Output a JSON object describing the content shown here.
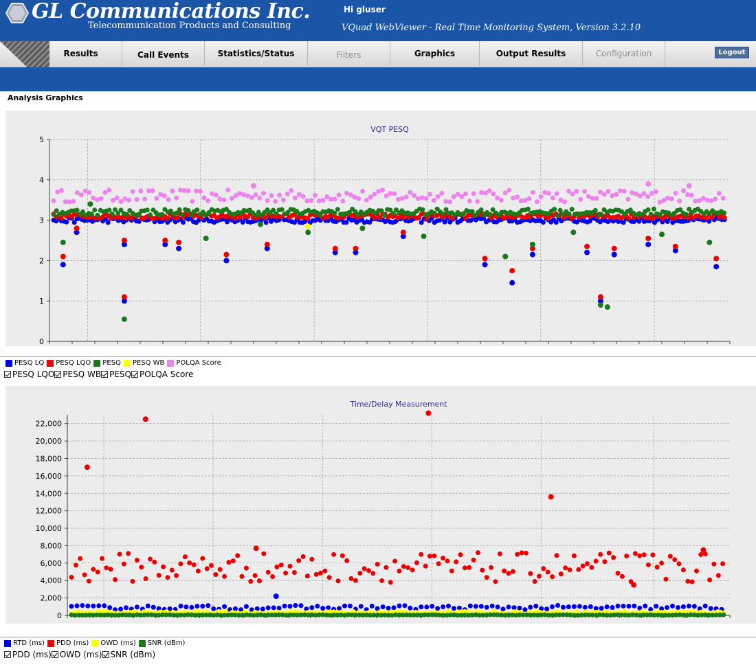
{
  "header": {
    "company": "GL Communications Inc.",
    "tagline": "Telecommunication Products and Consulting",
    "greeting": "Hi gluser",
    "app_title": "VQuad WebViewer - Real Time Monitoring System, Version 3.2.10",
    "logo_icon": "gl-hexagon-logo-icon"
  },
  "nav": {
    "tabs": [
      {
        "label": "Results"
      },
      {
        "label": "Call Events"
      },
      {
        "label": "Statistics/Status"
      },
      {
        "label": "Filters"
      },
      {
        "label": "Graphics"
      },
      {
        "label": "Output Results"
      },
      {
        "label": "Configuration"
      }
    ],
    "logout": "Logout"
  },
  "page": {
    "title": "Analysis Graphics"
  },
  "colors": {
    "banner": "#1a55a8",
    "plot_bg": "#ececec",
    "pesq_lq": "#0000ee",
    "pesq_lqo": "#ee0000",
    "pesq": "#1a7a1a",
    "pesq_wb": "#ffff00",
    "polqa": "#ee82ee",
    "rtd": "#0000ee",
    "pdd": "#ee0000",
    "owd": "#ffff00",
    "snr": "#1a7a1a"
  },
  "chart_data": [
    {
      "type": "scatter",
      "title": "VQT PESQ",
      "xlabel": "",
      "ylabel": "",
      "ylim": [
        0,
        5
      ],
      "yticks": [
        "0",
        "1",
        "2",
        "3",
        "4",
        "5"
      ],
      "grid": true,
      "legend_placement": "bottom-left",
      "legend": [
        "PESQ LQ",
        "PESQ LQO",
        "PESQ",
        "PESQ WB",
        "POLQA Score"
      ],
      "toggles": [
        "PESQ LQO",
        "PESQ WB",
        "PESQ",
        "POLQA Score"
      ],
      "series": [
        {
          "name": "PESQ LQ",
          "base": 3.0,
          "outliers": [
            1.9,
            2.7,
            2.4,
            1.0,
            2.4,
            2.3,
            2.0,
            2.3,
            2.2,
            2.2,
            2.6,
            1.9,
            1.45,
            2.15,
            2.2,
            1.0,
            2.15,
            2.4,
            2.25,
            1.85
          ]
        },
        {
          "name": "PESQ LQO",
          "base": 3.1,
          "outliers": [
            2.1,
            2.8,
            2.5,
            1.1,
            2.5,
            2.45,
            2.15,
            2.4,
            2.3,
            2.3,
            2.7,
            2.05,
            1.75,
            2.3,
            2.35,
            1.1,
            2.3,
            2.55,
            2.35,
            2.05
          ]
        },
        {
          "name": "PESQ",
          "base": 3.2,
          "outliers": [
            2.45,
            3.4,
            0.55,
            2.55,
            2.9,
            2.7,
            2.8,
            2.6,
            2.1,
            2.4,
            2.7,
            0.9,
            0.85,
            2.65,
            2.45
          ]
        },
        {
          "name": "PESQ WB",
          "base": 2.85,
          "outliers": [
            2.85
          ]
        },
        {
          "name": "POLQA Score",
          "base": 3.6,
          "outliers": [
            3.85,
            3.9,
            3.85
          ]
        }
      ]
    },
    {
      "type": "scatter",
      "title": "Time/Delay Measurement",
      "xlabel": "",
      "ylabel": "",
      "ylim": [
        0,
        23000
      ],
      "yticks": [
        "0",
        "2,000",
        "4,000",
        "6,000",
        "8,000",
        "10,000",
        "12,000",
        "14,000",
        "16,000",
        "18,000",
        "20,000",
        "22,000"
      ],
      "grid": true,
      "legend_placement": "bottom-left",
      "legend": [
        "RTD (ms)",
        "PDD (ms)",
        "OWD (ms)",
        "SNR (dBm)"
      ],
      "toggles": [
        "PDD (ms)",
        "OWD (ms)",
        "SNR (dBm)"
      ],
      "series": [
        {
          "name": "RTD (ms)",
          "base": 900,
          "outliers": [
            2200
          ]
        },
        {
          "name": "PDD (ms)",
          "base": 5500,
          "outliers": [
            17000,
            22500,
            23200,
            13600,
            7700,
            3500,
            7500
          ]
        },
        {
          "name": "OWD (ms)",
          "base": 300,
          "outliers": []
        },
        {
          "name": "SNR (dBm)",
          "base": 50,
          "outliers": []
        }
      ]
    }
  ]
}
